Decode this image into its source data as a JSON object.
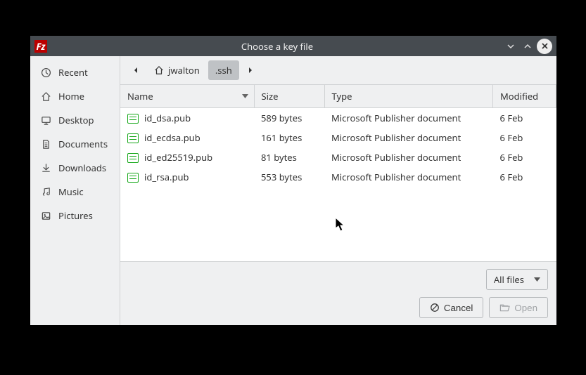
{
  "window": {
    "title": "Choose a key file"
  },
  "sidebar": {
    "items": [
      {
        "icon": "clock",
        "label": "Recent"
      },
      {
        "icon": "home",
        "label": "Home"
      },
      {
        "icon": "desktop",
        "label": "Desktop"
      },
      {
        "icon": "folder",
        "label": "Documents"
      },
      {
        "icon": "download",
        "label": "Downloads"
      },
      {
        "icon": "music",
        "label": "Music"
      },
      {
        "icon": "image",
        "label": "Pictures"
      }
    ]
  },
  "breadcrumb": {
    "segments": [
      {
        "label": "jwalton",
        "icon": "home",
        "current": false
      },
      {
        "label": ".ssh",
        "current": true
      }
    ]
  },
  "columns": {
    "name": "Name",
    "size": "Size",
    "type": "Type",
    "modified": "Modified"
  },
  "files": [
    {
      "name": "id_dsa.pub",
      "size": "589 bytes",
      "type": "Microsoft Publisher document",
      "modified": "6 Feb"
    },
    {
      "name": "id_ecdsa.pub",
      "size": "161 bytes",
      "type": "Microsoft Publisher document",
      "modified": "6 Feb"
    },
    {
      "name": "id_ed25519.pub",
      "size": "81 bytes",
      "type": "Microsoft Publisher document",
      "modified": "6 Feb"
    },
    {
      "name": "id_rsa.pub",
      "size": "553 bytes",
      "type": "Microsoft Publisher document",
      "modified": "6 Feb"
    }
  ],
  "filter": {
    "selected": "All files"
  },
  "actions": {
    "cancel": "Cancel",
    "open": "Open"
  }
}
